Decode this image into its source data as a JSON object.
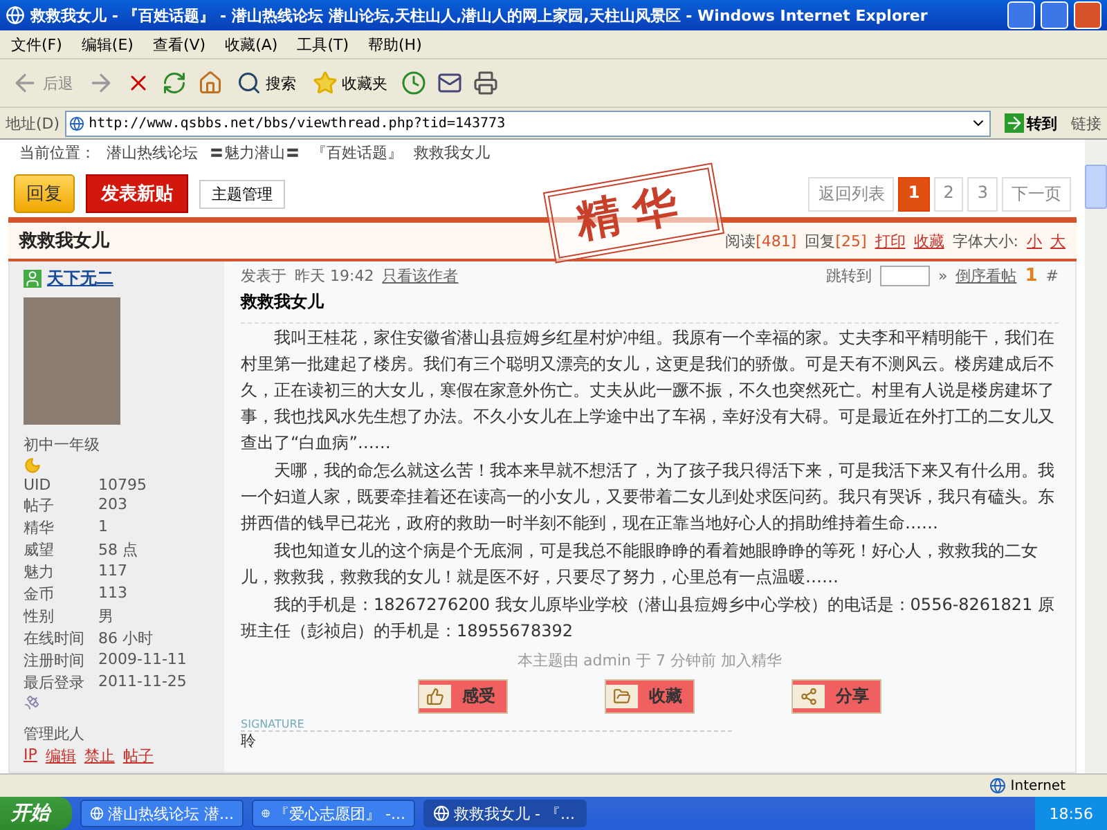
{
  "window": {
    "title": "救救我女儿 - 『百姓话题』 - 潜山热线论坛 潜山论坛,天柱山人,潜山人的网上家园,天柱山风景区 - Windows Internet Explorer"
  },
  "menu": [
    "文件(F)",
    "编辑(E)",
    "查看(V)",
    "收藏(A)",
    "工具(T)",
    "帮助(H)"
  ],
  "toolbar": {
    "back": "后退",
    "search": "搜索",
    "favorites": "收藏夹"
  },
  "address": {
    "label": "地址(D)",
    "url": "http://www.qsbbs.net/bbs/viewthread.php?tid=143773",
    "go": "转到",
    "links": "链接"
  },
  "breadcrumb": {
    "label": "当前位置：",
    "items": [
      "潜山热线论坛",
      "〓魅力潜山〓",
      "『百姓话题』",
      "救救我女儿"
    ]
  },
  "actions": {
    "reply": "回复",
    "new_post": "发表新贴",
    "manage": "主题管理"
  },
  "pagination": {
    "back": "返回列表",
    "pages": [
      {
        "label": "1",
        "selected": true
      },
      {
        "label": "2",
        "selected": false
      },
      {
        "label": "3",
        "selected": false
      }
    ],
    "next": "下一页"
  },
  "thread": {
    "title": "救救我女儿",
    "stamp": "精华",
    "stats": [
      {
        "label": "阅读",
        "value": "[481]"
      },
      {
        "label": "回复",
        "value": "[25]"
      }
    ],
    "links": [
      "打印",
      "收藏"
    ],
    "font_label": "字体大小:",
    "font_options": [
      "小",
      "大"
    ]
  },
  "post": {
    "author": "天下无二",
    "rank": "初中一年级",
    "profile": [
      {
        "key": "UID",
        "value": "10795"
      },
      {
        "key": "帖子",
        "value": "203"
      },
      {
        "key": "精华",
        "value": "1"
      },
      {
        "key": "威望",
        "value": "58 点"
      },
      {
        "key": "魅力",
        "value": "117"
      },
      {
        "key": "金币",
        "value": "113"
      },
      {
        "key": "性别",
        "value": "男"
      },
      {
        "key": "在线时间",
        "value": "86 小时"
      },
      {
        "key": "注册时间",
        "value": "2009-11-11"
      },
      {
        "key": "最后登录",
        "value": "2011-11-25"
      }
    ],
    "manage_label": "管理此人",
    "manage_links": [
      "IP",
      "编辑",
      "禁止",
      "帖子"
    ],
    "posted_label": "发表于",
    "posted_time": "昨天 19:42",
    "author_only": "只看该作者",
    "jump_label": "跳转到",
    "jump_go": "»",
    "reverse": "倒序看帖",
    "floor": "1",
    "floor_mark": "#",
    "title": "救救我女儿",
    "paragraphs": [
      "我叫王桂花，家住安徽省潜山县痘姆乡红星村炉冲组。我原有一个幸福的家。丈夫李和平精明能干，我们在村里第一批建起了楼房。我们有三个聪明又漂亮的女儿，这更是我们的骄傲。可是天有不测风云。楼房建成后不久，正在读初三的大女儿，寒假在家意外伤亡。丈夫从此一蹶不振，不久也突然死亡。村里有人说是楼房建坏了事，我也找风水先生想了办法。不久小女儿在上学途中出了车祸，幸好没有大碍。可是最近在外打工的二女儿又查出了“白血病”……",
      "天哪，我的命怎么就这么苦！我本来早就不想活了，为了孩子我只得活下来，可是我活下来又有什么用。我一个妇道人家，既要牵挂着还在读高一的小女儿，又要带着二女儿到处求医问药。我只有哭诉，我只有磕头。东拼西借的钱早已花光，政府的救助一时半刻不能到，现在正靠当地好心人的捐助维持着生命……",
      "我也知道女儿的这个病是个无底洞，可是我总不能眼睁睁的看着她眼睁睁的等死！好心人，救救我的二女儿，救救我，救救我的女儿！就是医不好，只要尽了努力，心里总有一点温暖……",
      "我的手机是：18267276200  我女儿原毕业学校（潜山县痘姆乡中心学校）的电话是：0556-8261821  原班主任（彭祯启）的手机是：18955678392"
    ],
    "moderation": "本主题由 admin 于 7 分钟前 加入精华",
    "buttons": [
      {
        "kind": "thumb",
        "label": "感受"
      },
      {
        "kind": "folder",
        "label": "收藏"
      },
      {
        "kind": "share",
        "label": "分享"
      }
    ],
    "signature_label": "SIGNATURE",
    "signature": "聆"
  },
  "status_bar": {
    "zone": "Internet"
  },
  "taskbar": {
    "start": "开始",
    "tasks": [
      {
        "label": "潜山热线论坛 潜...",
        "selected": false
      },
      {
        "label": "『爱心志愿团』 -...",
        "selected": false
      },
      {
        "label": "救救我女儿 - 『...",
        "selected": true
      }
    ],
    "time": "18:56"
  }
}
